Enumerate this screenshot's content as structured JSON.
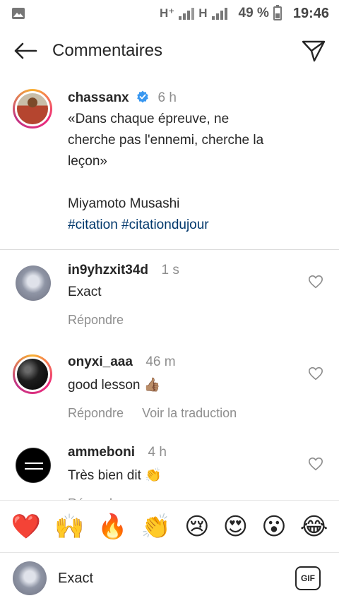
{
  "status_bar": {
    "icons": [
      "image-icon",
      "signal-h-plus-icon",
      "signal-h-icon",
      "battery-icon"
    ],
    "network_1": "H⁺",
    "network_2": "H",
    "battery": "49 %",
    "time": "19:46"
  },
  "header": {
    "title": "Commentaires",
    "back_icon": "arrow-left-icon",
    "send_icon": "send-icon"
  },
  "caption": {
    "username": "chassanx",
    "verified": true,
    "time": "6 h",
    "line1": "«Dans chaque épreuve, ne",
    "line2": "cherche pas l'ennemi, cherche la",
    "line3": "leçon»",
    "author": "Miyamoto Musashi",
    "hashtags": "#citation #citationdujour"
  },
  "comments": [
    {
      "username": "in9yhzxit34d",
      "time": "1 s",
      "text": "Exact",
      "reply": "Répondre",
      "translate": ""
    },
    {
      "username": "onyxi_aaa",
      "time": "46 m",
      "text": "good lesson 👍🏽",
      "reply": "Répondre",
      "translate": "Voir la traduction"
    },
    {
      "username": "ammeboni",
      "time": "4 h",
      "text": "Très bien dit 👏",
      "reply": "Répondre",
      "translate": ""
    }
  ],
  "emoji_bar": [
    "❤️",
    "🙌",
    "🔥",
    "👏",
    "😢",
    "😍",
    "😮",
    "😂"
  ],
  "input": {
    "value": "Exact",
    "gif_label": "GIF"
  },
  "colors": {
    "text": "#262626",
    "secondary": "#8e8e8e",
    "hashtag": "#00376b",
    "verified": "#3897f0"
  }
}
